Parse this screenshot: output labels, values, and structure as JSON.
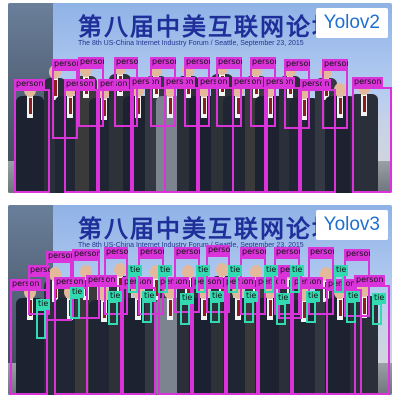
{
  "image_description": "Two stacked photos of the same group photo at a forum, with object-detection bounding boxes drawn over the people. Top panel labeled Yolov2, bottom panel labeled Yolov3.",
  "banner": {
    "title": "第八届中美互联网论坛",
    "subtitle": "The 8th US-China Internet Industry Forum / Seattle, September 23, 2015"
  },
  "colors": {
    "person_box": "#d933d9",
    "tie_box": "#33d9b0",
    "label_text": "#1f6fd1"
  },
  "panels": [
    {
      "label": "Yolov2",
      "detections": [
        {
          "label": "person"
        },
        {
          "label": "person"
        },
        {
          "label": "person"
        },
        {
          "label": "person"
        },
        {
          "label": "person"
        },
        {
          "label": "person"
        },
        {
          "label": "person"
        },
        {
          "label": "person"
        },
        {
          "label": "person"
        },
        {
          "label": "person"
        },
        {
          "label": "person"
        },
        {
          "label": "person"
        },
        {
          "label": "person"
        },
        {
          "label": "person"
        },
        {
          "label": "person"
        },
        {
          "label": "person"
        },
        {
          "label": "person"
        },
        {
          "label": "person"
        },
        {
          "label": "person"
        }
      ]
    },
    {
      "label": "Yolov3",
      "detections": [
        {
          "label": "person"
        },
        {
          "label": "person"
        },
        {
          "label": "person"
        },
        {
          "label": "person"
        },
        {
          "label": "person"
        },
        {
          "label": "person"
        },
        {
          "label": "person"
        },
        {
          "label": "person"
        },
        {
          "label": "person"
        },
        {
          "label": "person"
        },
        {
          "label": "person"
        },
        {
          "label": "person"
        },
        {
          "label": "person"
        },
        {
          "label": "person"
        },
        {
          "label": "person"
        },
        {
          "label": "person"
        },
        {
          "label": "person"
        },
        {
          "label": "person"
        },
        {
          "label": "person"
        },
        {
          "label": "person"
        },
        {
          "label": "person"
        },
        {
          "label": "person"
        },
        {
          "label": "person"
        },
        {
          "label": "tie"
        },
        {
          "label": "tie"
        },
        {
          "label": "tie"
        },
        {
          "label": "tie"
        },
        {
          "label": "tie"
        },
        {
          "label": "tie"
        },
        {
          "label": "tie"
        },
        {
          "label": "tie"
        },
        {
          "label": "tie"
        },
        {
          "label": "tie"
        },
        {
          "label": "tie"
        },
        {
          "label": "tie"
        },
        {
          "label": "tie"
        },
        {
          "label": "tie"
        },
        {
          "label": "tie"
        },
        {
          "label": "tie"
        },
        {
          "label": "tie"
        },
        {
          "label": "tie"
        }
      ]
    }
  ]
}
